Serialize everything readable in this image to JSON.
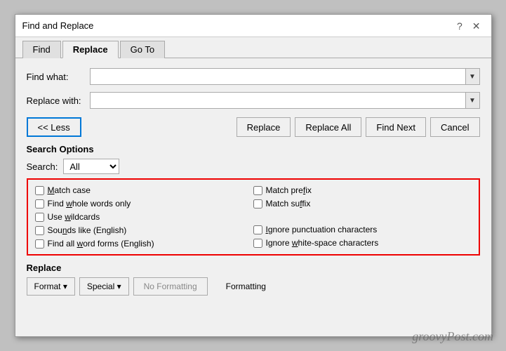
{
  "title": "Find and Replace",
  "help_btn": "?",
  "close_btn": "✕",
  "tabs": [
    {
      "label": "Find",
      "active": false
    },
    {
      "label": "Replace",
      "active": true
    },
    {
      "label": "Go To",
      "active": false
    }
  ],
  "find_label": "Find what:",
  "replace_label": "Replace with:",
  "find_dropdown_arrow": "▼",
  "replace_dropdown_arrow": "▼",
  "buttons": {
    "less": "<< Less",
    "replace": "Replace",
    "replace_all": "Replace All",
    "find_next": "Find Next",
    "cancel": "Cancel"
  },
  "search_options_title": "Search Options",
  "search_label": "Search:",
  "search_value": "All",
  "search_arrow": "▼",
  "checkboxes": {
    "left": [
      {
        "label": "Match case",
        "underline_idx": 0,
        "checked": false
      },
      {
        "label": "Find whole words only",
        "underline_idx": 5,
        "checked": false
      },
      {
        "label": "Use wildcards",
        "underline_idx": 4,
        "checked": false
      },
      {
        "label": "Sounds like (English)",
        "underline_idx": 7,
        "checked": false
      },
      {
        "label": "Find all word forms (English)",
        "underline_idx": 8,
        "checked": false
      }
    ],
    "right": [
      {
        "label": "Match prefix",
        "underline_idx": 6,
        "checked": false
      },
      {
        "label": "Match suffix",
        "underline_idx": 6,
        "checked": false
      },
      {
        "label": "Ignore punctuation characters",
        "underline_idx": 7,
        "checked": false
      },
      {
        "label": "Ignore white-space characters",
        "underline_idx": 7,
        "checked": false
      }
    ]
  },
  "replace_section_title": "Replace",
  "format_btn": "Format ▾",
  "special_btn": "Special ▾",
  "no_formatting_btn": "No Formatting",
  "formatting_label": "Formatting",
  "watermark": "groovyPost.com"
}
